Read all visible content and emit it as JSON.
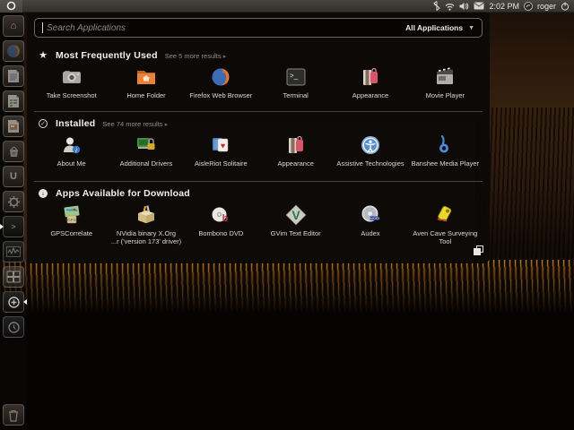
{
  "panel": {
    "clock": "2:02 PM",
    "username": "roger"
  },
  "dash": {
    "search": {
      "placeholder": "Search Applications",
      "filter": "All Applications",
      "chevron": "▼"
    },
    "sections": [
      {
        "title": "Most Frequently Used",
        "more": "See 5 more results",
        "more_arrow": "▸",
        "apps": [
          {
            "label": "Take Screenshot"
          },
          {
            "label": "Home Folder"
          },
          {
            "label": "Firefox Web Browser"
          },
          {
            "label": "Terminal"
          },
          {
            "label": "Appearance"
          },
          {
            "label": "Movie Player"
          }
        ]
      },
      {
        "title": "Installed",
        "more": "See 74 more results",
        "more_arrow": "▸",
        "apps": [
          {
            "label": "About Me"
          },
          {
            "label": "Additional Drivers"
          },
          {
            "label": "AisleRiot Solitaire"
          },
          {
            "label": "Appearance"
          },
          {
            "label": "Assistive Technologies"
          },
          {
            "label": "Banshee Media Player"
          }
        ]
      },
      {
        "title": "Apps Available for Download",
        "more": "",
        "more_arrow": "",
        "apps": [
          {
            "label": "GPSCorrelate"
          },
          {
            "label": "NVidia binary X.Org\n...r ('version 173' driver)"
          },
          {
            "label": "Bombono DVD"
          },
          {
            "label": "GVim Text Editor"
          },
          {
            "label": "Audex"
          },
          {
            "label": "Aven Cave Surveying Tool"
          }
        ]
      }
    ]
  },
  "icon_glyphs": {
    "check": "✓",
    "download_arrow": "↓",
    "star": "★",
    "terminal_prompt": ">_",
    "launcher_prompt": ">",
    "house": "⌂",
    "ubuntu_one": "U",
    "heart": "♥",
    "info_i": "i",
    "gvim_v": "V",
    "bombono_b": "b",
    "audex_label": "AUDEX",
    "gps_label": "GPS"
  },
  "launcher": {
    "items": [
      "home-folder",
      "firefox",
      "libreoffice-writer",
      "libreoffice-calc",
      "libreoffice-impress",
      "ubuntu-software-center",
      "ubuntu-one",
      "system-settings",
      "terminal",
      "media-player",
      "workspace-switcher",
      "applications-lens",
      "files-lens",
      "trash"
    ]
  },
  "colors": {
    "panel_bg": "#3c3a35",
    "dash_bg": "#0b0907",
    "accent_orange": "#e8732a",
    "text_primary": "#f2f2f0",
    "text_secondary": "#8f8f8b",
    "sunset_brown": "#54311a",
    "grass_orange": "#c8852f"
  }
}
